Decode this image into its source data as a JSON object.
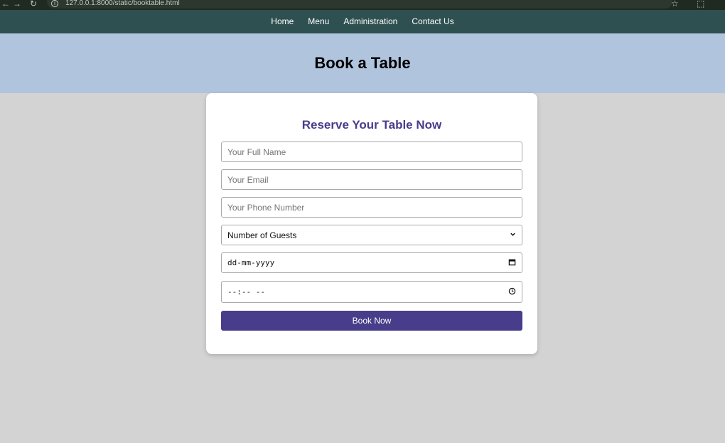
{
  "browser": {
    "back": "←",
    "forward": "→",
    "reload": "↻",
    "info": "i",
    "url": "127.0.0.1:8000/static/booktable.html",
    "star": "☆",
    "extensions": "⬚"
  },
  "navbar": {
    "items": [
      {
        "label": "Home"
      },
      {
        "label": "Menu"
      },
      {
        "label": "Administration"
      },
      {
        "label": "Contact Us"
      }
    ]
  },
  "hero": {
    "title": "Book a Table"
  },
  "form": {
    "heading": "Reserve Your Table Now",
    "name_placeholder": "Your Full Name",
    "email_placeholder": "Your Email",
    "phone_placeholder": "Your Phone Number",
    "guests_selected": "Number of Guests",
    "date_value": "dd-mm-yyyy",
    "time_value": "--:-- --",
    "submit_label": "Book Now"
  },
  "icons": {
    "chevron": "chevron-down-icon",
    "calendar": "calendar-icon",
    "clock": "clock-icon"
  },
  "colors": {
    "navbar": "#2f5050",
    "hero": "#b0c4de",
    "accent": "#483d8b",
    "page": "#d3d3d3"
  }
}
